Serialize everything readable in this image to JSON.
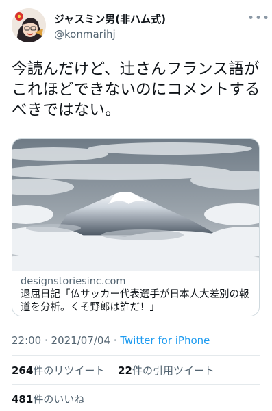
{
  "author": {
    "name": "ジャスミン男(非ハム式)",
    "handle": "@konmarihj"
  },
  "tweet": {
    "text": "今読んだけど、辻さんフランス語がこれほどできないのにコメントするべきではない。"
  },
  "card": {
    "domain": "designstoriesinc.com",
    "title": "退屈日記「仏サッカー代表選手が日本人大差別の報道を分析。くそ野郎は誰だ！」"
  },
  "meta": {
    "time": "22:00",
    "separator": " · ",
    "date": "2021/07/04",
    "separator2": " · ",
    "source": "Twitter for iPhone"
  },
  "stats": {
    "retweets_count": "264",
    "retweets_label": "件のリツイート",
    "quotes_count": "22",
    "quotes_label": "件の引用ツイート",
    "likes_count": "481",
    "likes_label": "件のいいね"
  },
  "colors": {
    "link": "#1d9bf0",
    "secondary_text": "#536471",
    "border": "#cfd9de"
  },
  "icons": {
    "more": "more-icon"
  }
}
